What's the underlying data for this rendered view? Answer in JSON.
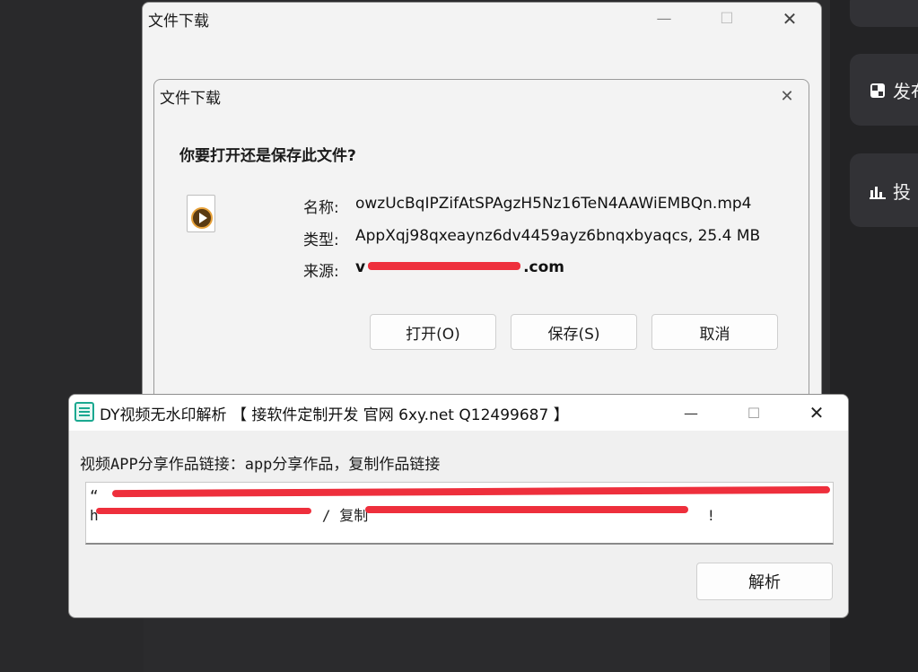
{
  "side_panel": {
    "items": [
      {
        "label": "发布",
        "icon": "layout-icon"
      },
      {
        "label": "投",
        "icon": "bar-chart-icon"
      }
    ]
  },
  "outer_window": {
    "title": "文件下载",
    "controls": {
      "minimize": "—",
      "maximize": "☐",
      "close": "✕"
    }
  },
  "dialog": {
    "title": "文件下载",
    "close": "✕",
    "prompt": "你要打开还是保存此文件?",
    "file_icon": "video-file-icon",
    "name_label": "名称:",
    "name_value": "owzUcBqIPZifAtSPAgzH5Nz16TeN4AAWiEMBQn.mp4",
    "type_label": "类型:",
    "type_value": "AppXqj98qxeaynz6dv4459ayz6bnqxbyaqcs, 25.4 MB",
    "source_label": "来源:",
    "source_prefix": "v",
    "source_suffix": ".com",
    "buttons": {
      "open": "打开(O)",
      "save": "保存(S)",
      "cancel": "取消"
    }
  },
  "dy_window": {
    "title": "DY视频无水印解析 【 接软件定制开发 官网 6xy.net Q12499687 】",
    "controls": {
      "minimize": "—",
      "maximize": "☐",
      "close": "✕"
    },
    "label": "视频APP分享作品链接：app分享作品，复制作品链接",
    "text_line1": "“",
    "text_line2_start": "h",
    "text_line2_mid": "/ 复制",
    "text_line2_end": "!",
    "parse_button": "解析"
  },
  "colors": {
    "redaction": "#ee2f3c",
    "dark_bg": "#2b2b2d",
    "window_bg": "#f3f3f3"
  }
}
